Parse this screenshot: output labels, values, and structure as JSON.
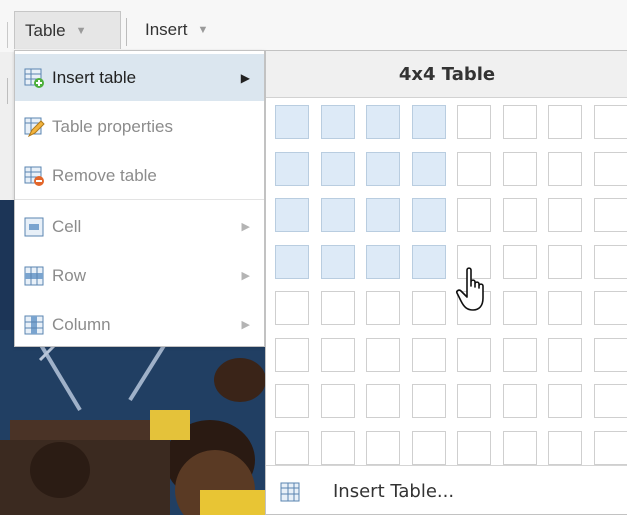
{
  "menubar": {
    "table_label": "Table",
    "insert_label": "Insert"
  },
  "dropdown": {
    "items": [
      {
        "label": "Insert table",
        "icon": "insert-table-icon",
        "submenu": true,
        "active": true
      },
      {
        "label": "Table properties",
        "icon": "table-properties-icon",
        "submenu": false,
        "active": false
      },
      {
        "label": "Remove table",
        "icon": "remove-table-icon",
        "submenu": false,
        "active": false
      },
      {
        "label": "Cell",
        "icon": "cell-icon",
        "submenu": true,
        "active": false
      },
      {
        "label": "Row",
        "icon": "row-icon",
        "submenu": true,
        "active": false
      },
      {
        "label": "Column",
        "icon": "column-icon",
        "submenu": true,
        "active": false
      }
    ]
  },
  "grid_picker": {
    "title": "4x4 Table",
    "selected_rows": 4,
    "selected_cols": 4,
    "footer_label": "Insert Table..."
  },
  "colors": {
    "highlight": "#dbe6ef",
    "cell_selected": "#ddeaf7"
  }
}
